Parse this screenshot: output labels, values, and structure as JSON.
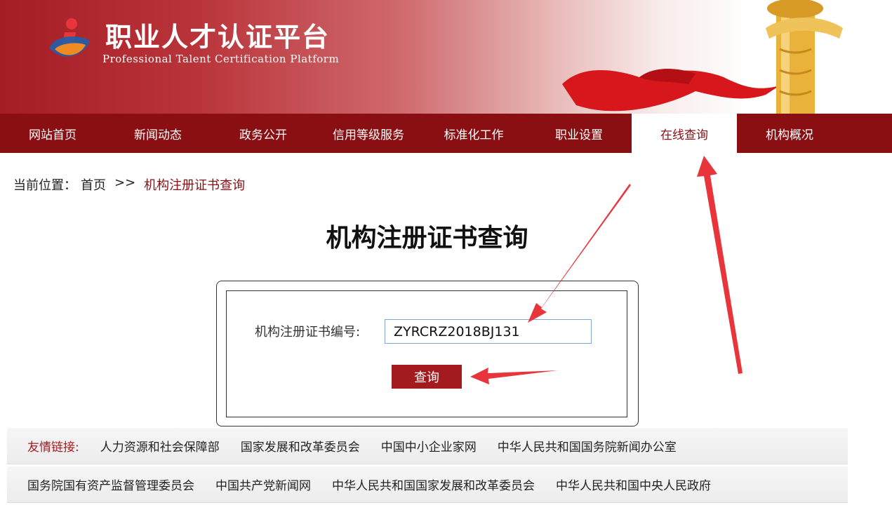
{
  "header": {
    "title": "职业人才认证平台",
    "subtitle": "Professional Talent Certification Platform"
  },
  "nav": {
    "items": [
      {
        "label": "网站首页"
      },
      {
        "label": "新闻动态"
      },
      {
        "label": "政务公开"
      },
      {
        "label": "信用等级服务"
      },
      {
        "label": "标准化工作"
      },
      {
        "label": "职业设置"
      },
      {
        "label": "在线查询",
        "active": true
      },
      {
        "label": "机构概况"
      }
    ]
  },
  "breadcrumb": {
    "prefix": "当前位置：",
    "home": "首页",
    "separator": ">>",
    "current": "机构注册证书查询"
  },
  "page": {
    "title": "机构注册证书查询"
  },
  "query": {
    "label": "机构注册证书编号:",
    "value": "ZYRCRZ2018BJ131",
    "button_label": "查询"
  },
  "links": {
    "label": "友情链接:",
    "row1": [
      "人力资源和社会保障部",
      "国家发展和改革委员会",
      "中国中小企业家网",
      "中华人民共和国国务院新闻办公室"
    ],
    "row2": [
      "国务院国有资产监督管理委员会",
      "中国共产党新闻网",
      "中华人民共和国国家发展和改革委员会",
      "中华人民共和国中央人民政府"
    ]
  },
  "colors": {
    "brand": "#8a0f12",
    "button": "#a31b1f",
    "input_border": "#7ea6d6",
    "annotation": "#e8353b"
  },
  "icons": {
    "logo": "person-logo-icon",
    "banner_art": "huabiao-pillar-ribbon"
  }
}
